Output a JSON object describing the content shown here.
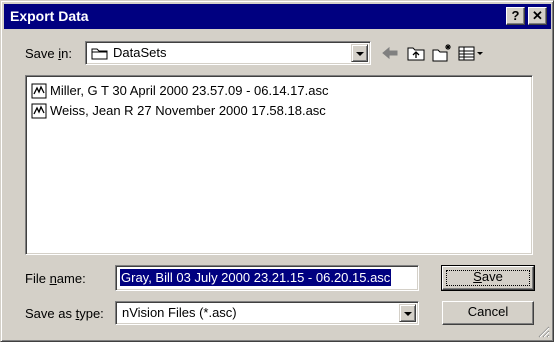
{
  "window": {
    "title": "Export Data",
    "help_glyph": "?",
    "close_glyph": "✕"
  },
  "save_in": {
    "label_pre": "Save ",
    "label_mnemonic": "i",
    "label_post": "n:",
    "value": "DataSets",
    "icon": "folder-icon"
  },
  "toolbar": {
    "icons": [
      "back-arrow-icon",
      "up-folder-icon",
      "new-folder-icon",
      "view-menu-icon"
    ]
  },
  "files": [
    {
      "name": "Miller, G T 30 April 2000 23.57.09 - 06.14.17.asc",
      "icon": "data-file-icon"
    },
    {
      "name": "Weiss, Jean R 27 November 2000 17.58.18.asc",
      "icon": "data-file-icon"
    }
  ],
  "file_name": {
    "label_pre": "File ",
    "label_mnemonic": "n",
    "label_post": "ame:",
    "value": "Gray, Bill  03 July 2000 23.21.15 - 06.20.15.asc"
  },
  "save_as_type": {
    "label_pre": "Save as ",
    "label_mnemonic": "t",
    "label_post": "ype:",
    "value": "nVision Files (*.asc)"
  },
  "buttons": {
    "save_mnemonic": "S",
    "save_rest": "ave",
    "cancel": "Cancel"
  },
  "colors": {
    "titlebar": "#000080",
    "face": "#d4d0c8",
    "selection": "#000080"
  }
}
